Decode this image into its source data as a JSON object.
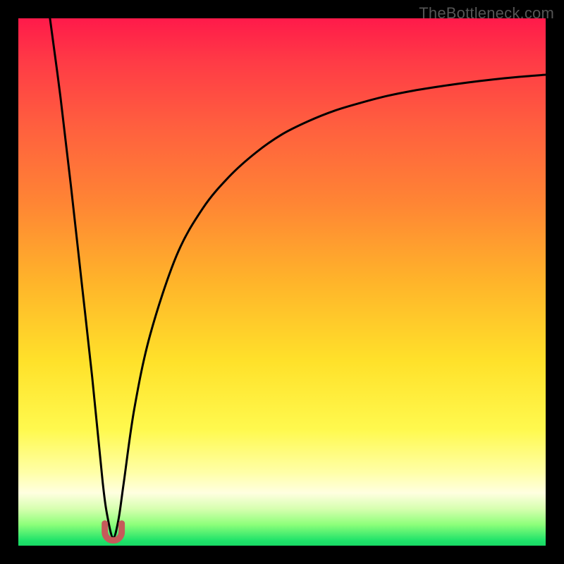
{
  "watermark": "TheBottleneck.com",
  "colors": {
    "frame": "#000000",
    "gradient_top": "#ff1a4a",
    "gradient_mid": "#ffe12a",
    "gradient_bottom": "#18d864",
    "curve_stroke": "#000000",
    "marker_fill": "#c65a5a",
    "marker_stroke": "#c65a5a"
  },
  "chart_data": {
    "type": "line",
    "title": "",
    "xlabel": "",
    "ylabel": "",
    "xlim": [
      0,
      100
    ],
    "ylim": [
      0,
      100
    ],
    "notes": "Heatmap-style background gradient from red (top, y≈100) through orange/yellow to green (bottom, y≈0). A single black curve drops steeply from upper-left to a minimum near x≈18, y≈1.5, then rises with decreasing slope toward the upper-right. A short rounded red 'u'-shaped marker sits at the bottom of the dip near x≈18.",
    "series": [
      {
        "name": "bottleneck-curve",
        "x": [
          6,
          8,
          10,
          12,
          14,
          16,
          17,
          18,
          19,
          20,
          22,
          25,
          30,
          35,
          40,
          45,
          50,
          55,
          60,
          65,
          70,
          75,
          80,
          85,
          90,
          95,
          100
        ],
        "y": [
          100,
          85,
          68,
          50,
          32,
          12,
          5,
          1.5,
          5,
          12,
          26,
          40,
          55,
          64,
          70,
          74.5,
          78,
          80.5,
          82.5,
          84,
          85.3,
          86.3,
          87.1,
          87.8,
          88.4,
          88.9,
          89.3
        ]
      }
    ],
    "marker": {
      "name": "minimum-marker",
      "x_center": 18,
      "y_bottom": 1.0,
      "width_x": 3.2,
      "height_y": 3.2
    }
  }
}
